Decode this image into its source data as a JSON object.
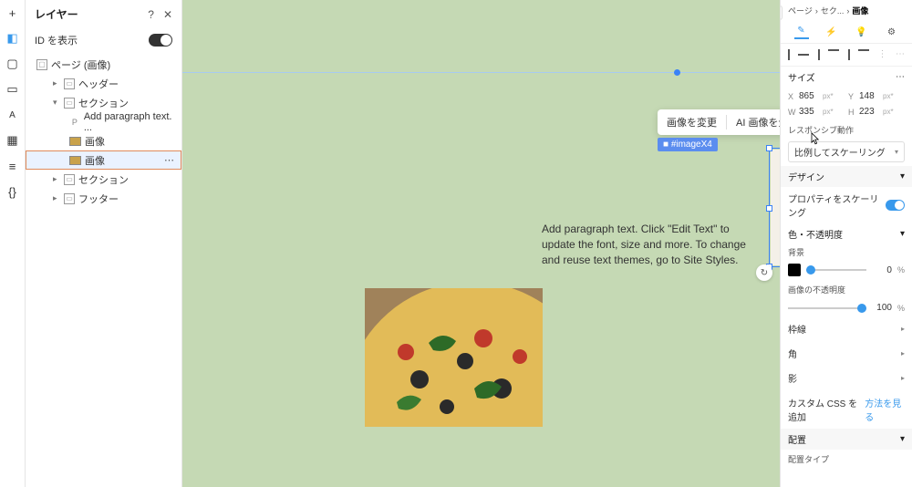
{
  "left_rail": {
    "icons": [
      "plus",
      "layers",
      "page",
      "section",
      "text",
      "grid",
      "db",
      "code"
    ]
  },
  "layers": {
    "title": "レイヤー",
    "help": "?",
    "close": "✕",
    "id_row": "ID を表示",
    "tree": {
      "root": "ページ (画像)",
      "items": [
        {
          "label": "ヘッダー"
        },
        {
          "label": "セクション",
          "open": true,
          "children": [
            {
              "label": "Add paragraph text. ...",
              "type": "P"
            },
            {
              "label": "画像",
              "type": "img"
            },
            {
              "label": "画像",
              "type": "img",
              "selected": true
            }
          ]
        },
        {
          "label": "セクション"
        },
        {
          "label": "フッター"
        }
      ]
    }
  },
  "canvas": {
    "toolbar": {
      "change": "画像を変更",
      "ai": "AI 画像を生成"
    },
    "badge": "■ #imageX4",
    "paragraph": "Add paragraph text. Click \"Edit Text\" to update the font, size and more. To change and reuse text themes, go to Site Styles."
  },
  "right": {
    "crumbs": {
      "a": "ページ",
      "b": "セク...",
      "c": "画像"
    },
    "size": {
      "title": "サイズ",
      "x_lbl": "X",
      "x": "865",
      "y_lbl": "Y",
      "y": "148",
      "w_lbl": "W",
      "w": "335",
      "h_lbl": "H",
      "h": "223",
      "unit": "px*"
    },
    "responsive": {
      "title": "レスポンシブ動作",
      "mode": "比例してスケーリング"
    },
    "design": {
      "title": "デザイン",
      "scaling": "プロパティをスケーリング"
    },
    "opacity": {
      "title": "色・不透明度",
      "bg": "背景",
      "bg_val": "0",
      "img": "画像の不透明度",
      "img_val": "100"
    },
    "border": "枠線",
    "corner": "角",
    "shadow": "影",
    "css": {
      "title": "カスタム CSS を追加",
      "link": "方法を見る"
    },
    "placement": {
      "title": "配置",
      "type": "配置タイプ"
    }
  }
}
